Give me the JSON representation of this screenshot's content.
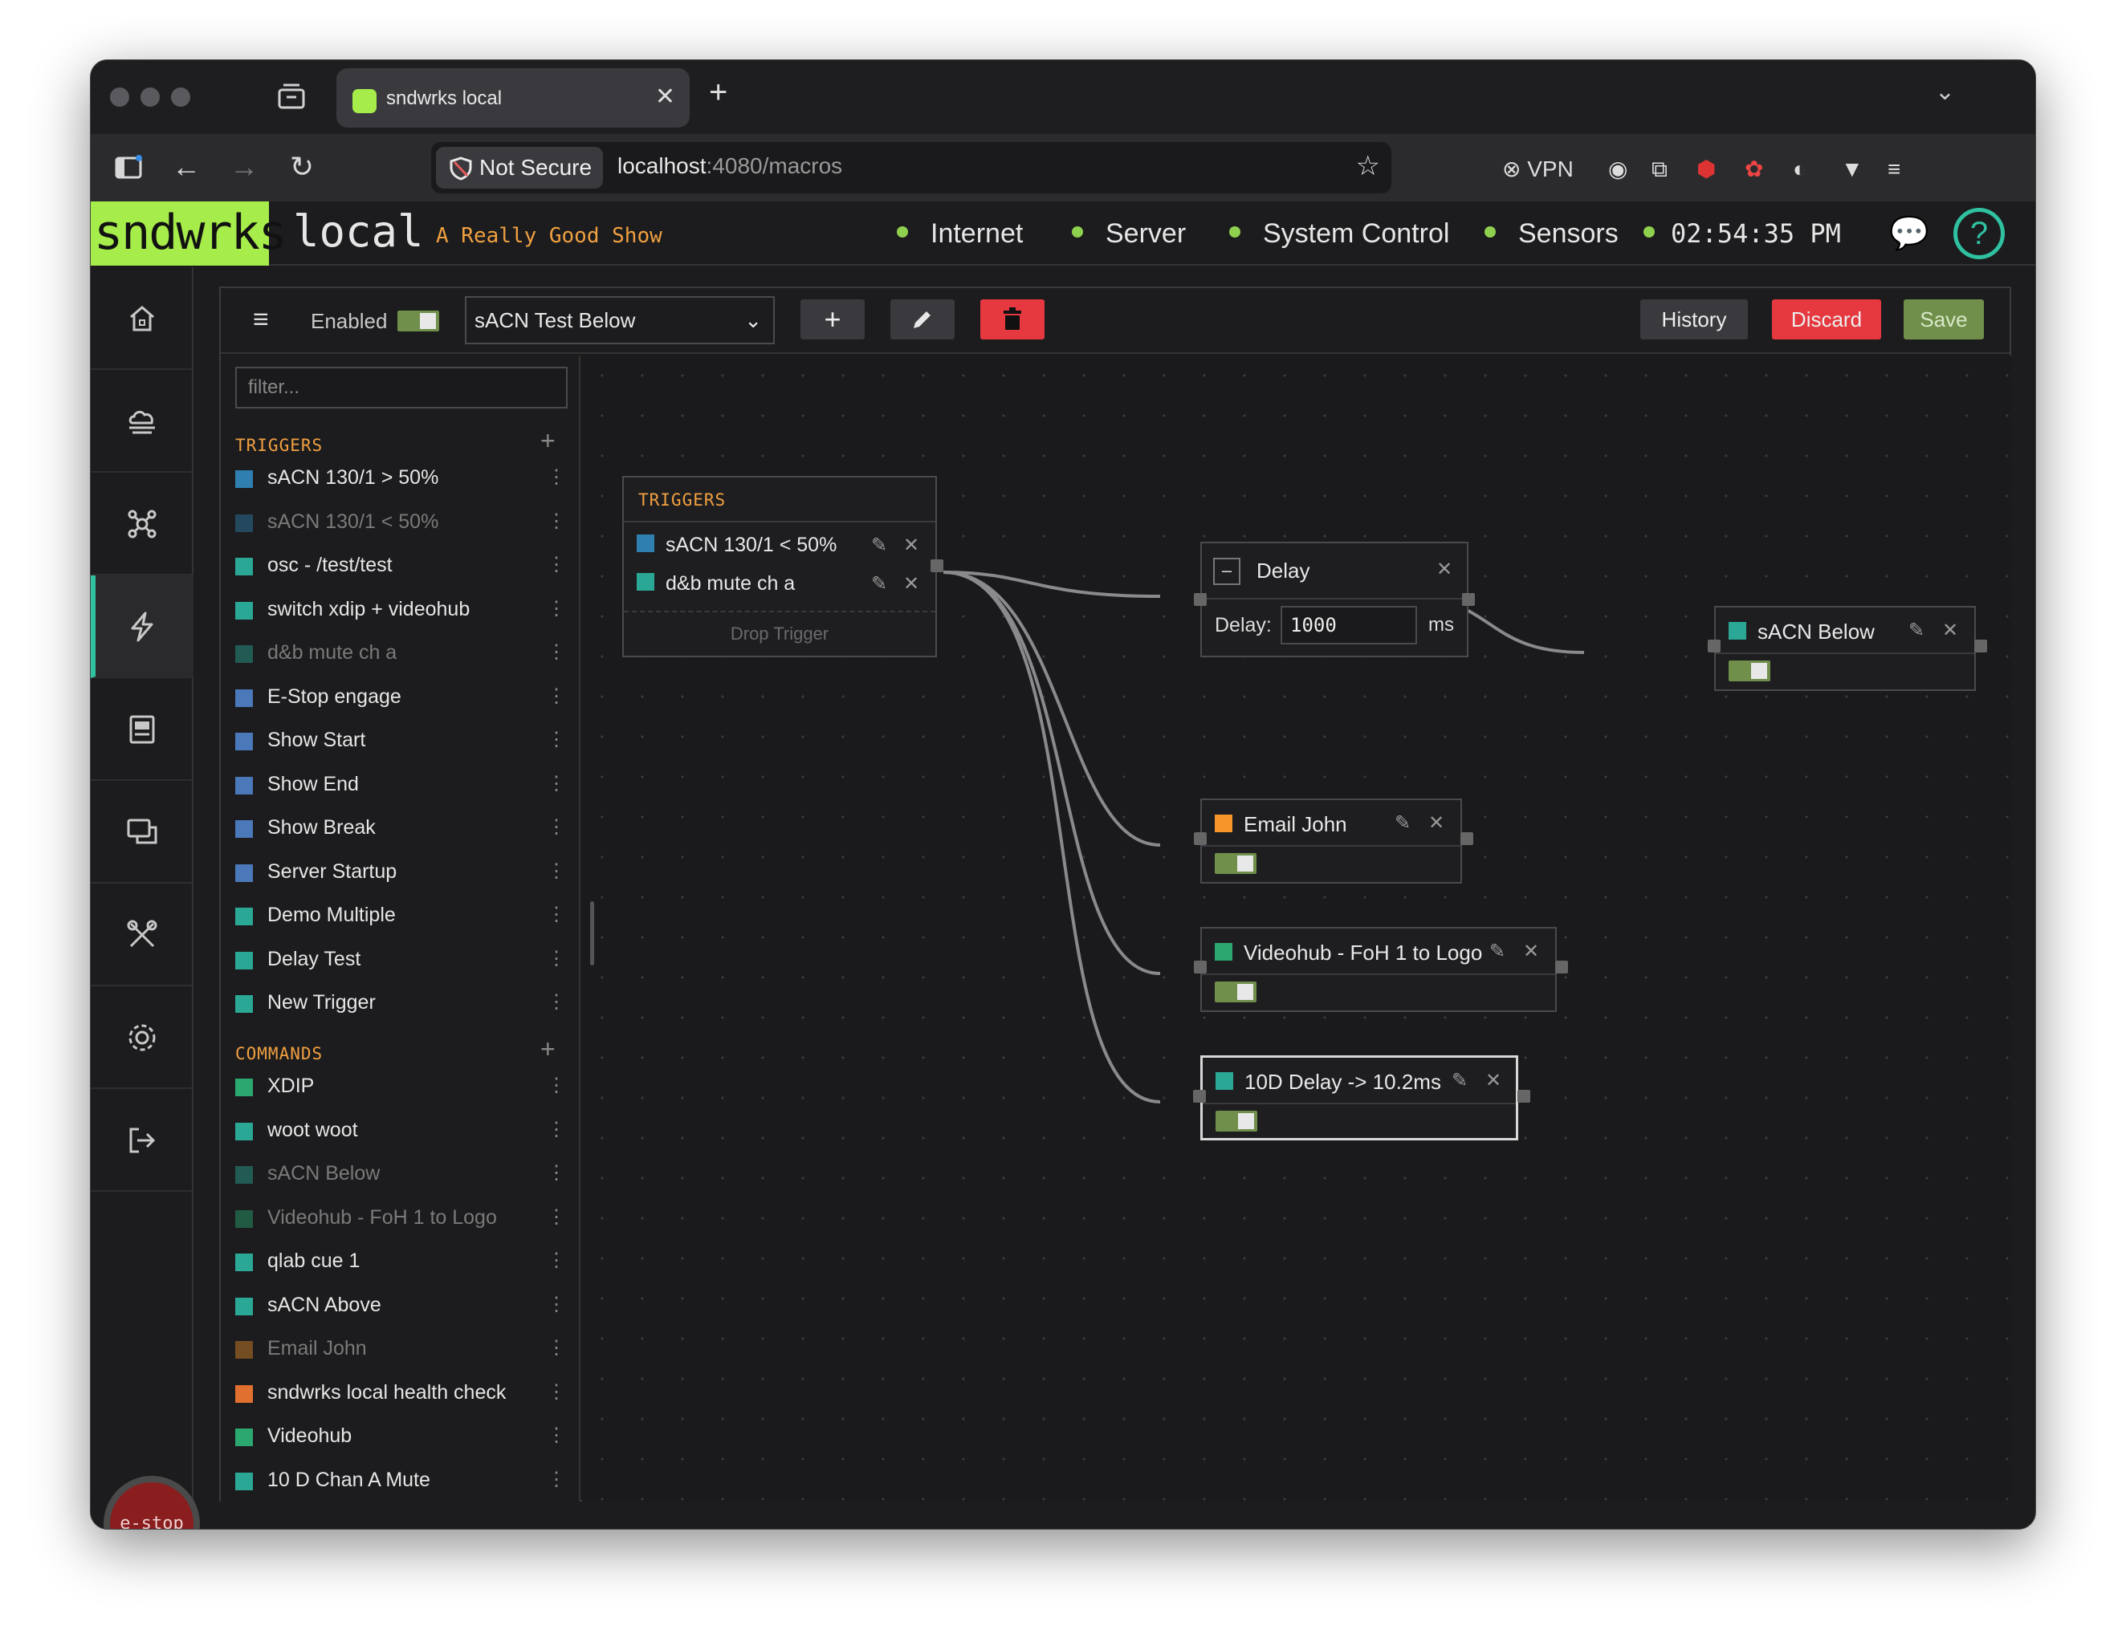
{
  "browser": {
    "tab_title": "sndwrks local",
    "not_secure": "Not Secure",
    "url_host": "localhost",
    "url_path": ":4080/macros",
    "vpn_label": "VPN"
  },
  "header": {
    "logo": "sndwrks",
    "local": "local",
    "show_name": "A Really Good Show",
    "status": [
      {
        "label": "Internet",
        "color": "#8fd14f"
      },
      {
        "label": "Server",
        "color": "#8fd14f"
      },
      {
        "label": "System Control",
        "color": "#8fd14f"
      },
      {
        "label": "Sensors",
        "color": "#8fd14f"
      }
    ],
    "clock": "02:54:35 PM",
    "help": "?"
  },
  "sidebar": {
    "items": [
      "home-icon",
      "cloud-icon",
      "network-icon",
      "macros-icon",
      "document-icon",
      "messages-icon",
      "tools-icon",
      "settings-icon",
      "logout-icon"
    ],
    "active": "macros-icon",
    "estop": "e-stop"
  },
  "toolbar": {
    "menu": "≡",
    "enabled_label": "Enabled",
    "enabled": true,
    "macro_selected": "sACN Test Below",
    "add": "+",
    "history": "History",
    "discard": "Discard",
    "save": "Save",
    "colors": {
      "delete": "#e5393f",
      "discard": "#e5393f",
      "save": "#6f8f4a"
    }
  },
  "panel": {
    "filter_placeholder": "filter...",
    "triggers_heading": "TRIGGERS",
    "triggers": [
      {
        "label": "sACN 130/1 > 50%",
        "color": "#2f80b0",
        "dim": false
      },
      {
        "label": "sACN 130/1 < 50%",
        "color": "#2f80b0",
        "dim": true
      },
      {
        "label": "osc - /test/test",
        "color": "#2aa895",
        "dim": false
      },
      {
        "label": "switch xdip + videohub",
        "color": "#2aa895",
        "dim": false
      },
      {
        "label": "d&b mute ch a",
        "color": "#2aa895",
        "dim": true
      },
      {
        "label": "E-Stop engage",
        "color": "#4a78b8",
        "dim": false
      },
      {
        "label": "Show Start",
        "color": "#4a78b8",
        "dim": false
      },
      {
        "label": "Show End",
        "color": "#4a78b8",
        "dim": false
      },
      {
        "label": "Show Break",
        "color": "#4a78b8",
        "dim": false
      },
      {
        "label": "Server Startup",
        "color": "#4a78b8",
        "dim": false
      },
      {
        "label": "Demo Multiple",
        "color": "#2aa895",
        "dim": false
      },
      {
        "label": "Delay Test",
        "color": "#2aa895",
        "dim": false
      },
      {
        "label": "New Trigger",
        "color": "#2aa895",
        "dim": false
      }
    ],
    "commands_heading": "COMMANDS",
    "commands": [
      {
        "label": "XDIP",
        "color": "#2aa870",
        "dim": false
      },
      {
        "label": "woot woot",
        "color": "#2aa895",
        "dim": false
      },
      {
        "label": "sACN Below",
        "color": "#2aa895",
        "dim": true
      },
      {
        "label": "Videohub - FoH 1 to Logo",
        "color": "#2aa870",
        "dim": true
      },
      {
        "label": "qlab cue 1",
        "color": "#2aa895",
        "dim": false
      },
      {
        "label": "sACN Above",
        "color": "#2aa895",
        "dim": false
      },
      {
        "label": "Email John",
        "color": "#e08a2a",
        "dim": true
      },
      {
        "label": "sndwrks local health check",
        "color": "#e07030",
        "dim": false
      },
      {
        "label": "Videohub",
        "color": "#2aa870",
        "dim": false
      },
      {
        "label": "10 D Chan A Mute",
        "color": "#2aa895",
        "dim": false
      }
    ]
  },
  "canvas": {
    "triggers_node": {
      "heading": "TRIGGERS",
      "items": [
        {
          "label": "sACN 130/1 < 50%",
          "color": "#2f80b0"
        },
        {
          "label": "d&b mute ch a",
          "color": "#2aa895"
        }
      ],
      "drop": "Drop Trigger"
    },
    "delay_node": {
      "title": "Delay",
      "field_label": "Delay:",
      "value": "1000",
      "unit": "ms",
      "collapse": "–"
    },
    "sacn_below": {
      "title": "sACN Below",
      "color": "#2aa895",
      "enabled": true
    },
    "email_john": {
      "title": "Email John",
      "color": "#f5952a",
      "enabled": true
    },
    "videohub": {
      "title": "Videohub - FoH 1 to Logo",
      "color": "#2aa870",
      "enabled": true
    },
    "d10_delay": {
      "title": "10D Delay -> 10.2ms",
      "color": "#2aa895",
      "enabled": true,
      "selected": true
    }
  }
}
